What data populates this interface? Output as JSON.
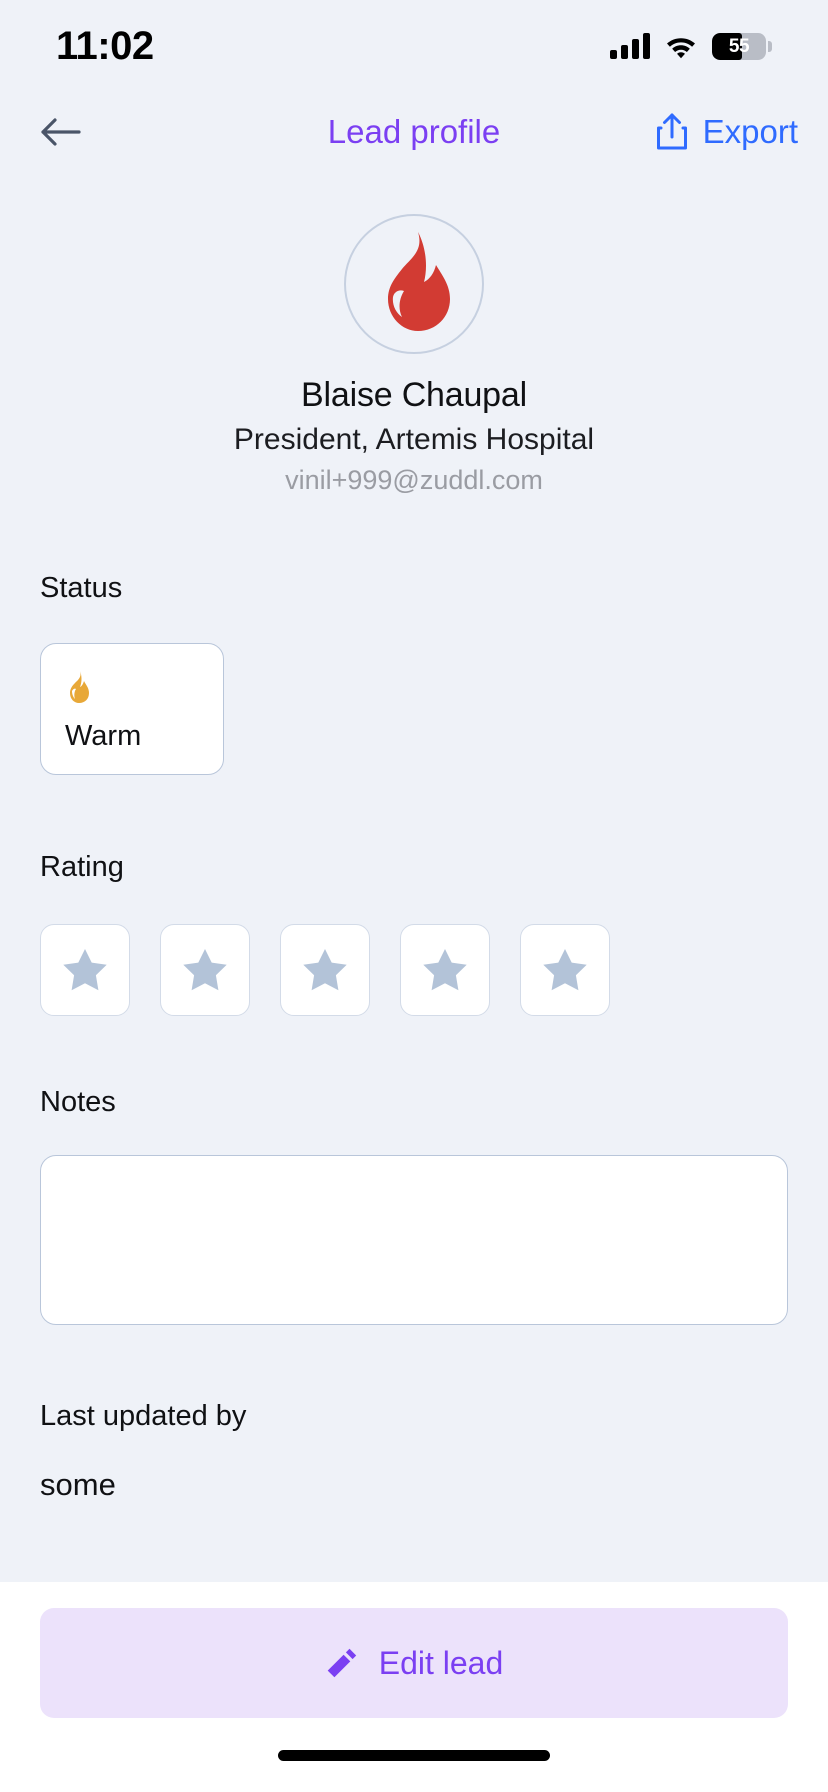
{
  "status_bar": {
    "time": "11:02",
    "cellular_icon": "cellular-signal-icon",
    "wifi_icon": "wifi-icon",
    "battery_percent": "55",
    "battery_level": 55
  },
  "navbar": {
    "back_icon": "arrow-left-icon",
    "title": "Lead profile",
    "export_icon": "share-upload-icon",
    "export_label": "Export",
    "title_color": "#7b3ff2",
    "export_color": "#2f6bff"
  },
  "profile": {
    "avatar_icon": "flame-icon",
    "avatar_icon_color": "#d23b33",
    "name": "Blaise Chaupal",
    "role": "President, Artemis Hospital",
    "email": "vinil+999@zuddl.com"
  },
  "status_section": {
    "label": "Status",
    "options": [
      {
        "icon": "flame-icon",
        "icon_color": "#e8a838",
        "label": "Warm",
        "selected": true
      }
    ]
  },
  "rating_section": {
    "label": "Rating",
    "max": 5,
    "value": 0,
    "star_icon": "star-icon",
    "star_color": "#b3c3d8"
  },
  "notes_section": {
    "label": "Notes",
    "value": "",
    "placeholder": ""
  },
  "last_updated_section": {
    "label": "Last updated by",
    "value": "some"
  },
  "bottom_bar": {
    "edit_icon": "pencil-icon",
    "edit_label": "Edit lead",
    "edit_bg": "#ece2fb",
    "edit_fg": "#7b3ff2"
  }
}
